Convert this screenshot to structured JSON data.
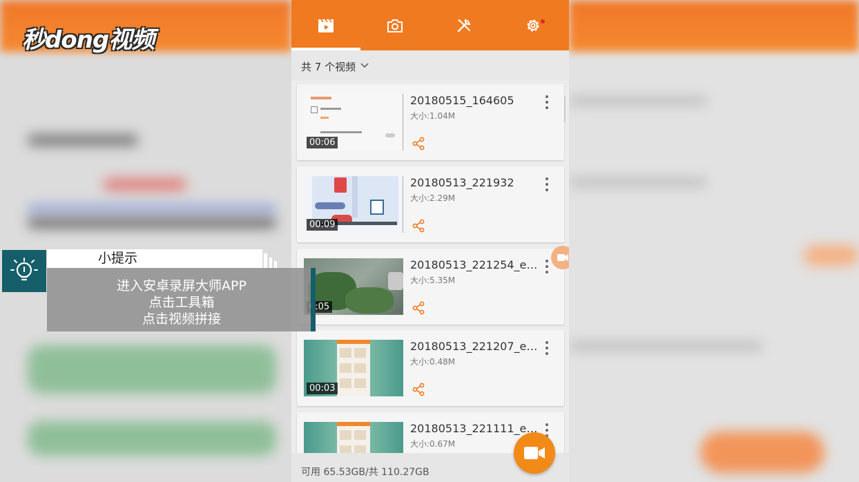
{
  "watermark": {
    "logo_text": "秒dong视频"
  },
  "tabs": [
    {
      "name": "videos",
      "icon": "video-clapper-icon",
      "active": true
    },
    {
      "name": "screenshots",
      "icon": "camera-icon",
      "active": false
    },
    {
      "name": "tools",
      "icon": "tools-icon",
      "active": false
    },
    {
      "name": "settings",
      "icon": "gear-icon",
      "active": false,
      "has_notification_dot": true
    }
  ],
  "video_count_label": "共 7 个视频",
  "videos": [
    {
      "name": "20180515_164605",
      "size": "大小:1.04M",
      "duration": "00:06"
    },
    {
      "name": "20180513_221932",
      "size": "大小:2.29M",
      "duration": "00:09"
    },
    {
      "name": "20180513_221254_edit...",
      "size": "大小:5.35M",
      "duration": "0:05"
    },
    {
      "name": "20180513_221207_edit...",
      "size": "大小:0.48M",
      "duration": "00:03"
    },
    {
      "name": "20180513_221111_edit...",
      "size": "大小:0.67M",
      "duration": ""
    }
  ],
  "storage_label": "可用 65.53GB/共 110.27GB",
  "tip": {
    "title": "小提示",
    "lines": [
      "进入安卓录屏大师APP",
      "点击工具箱",
      "点击视频拼接"
    ]
  },
  "colors": {
    "accent": "#f07a20",
    "tip_teal": "#155e6a",
    "fab": "#f28a18"
  }
}
